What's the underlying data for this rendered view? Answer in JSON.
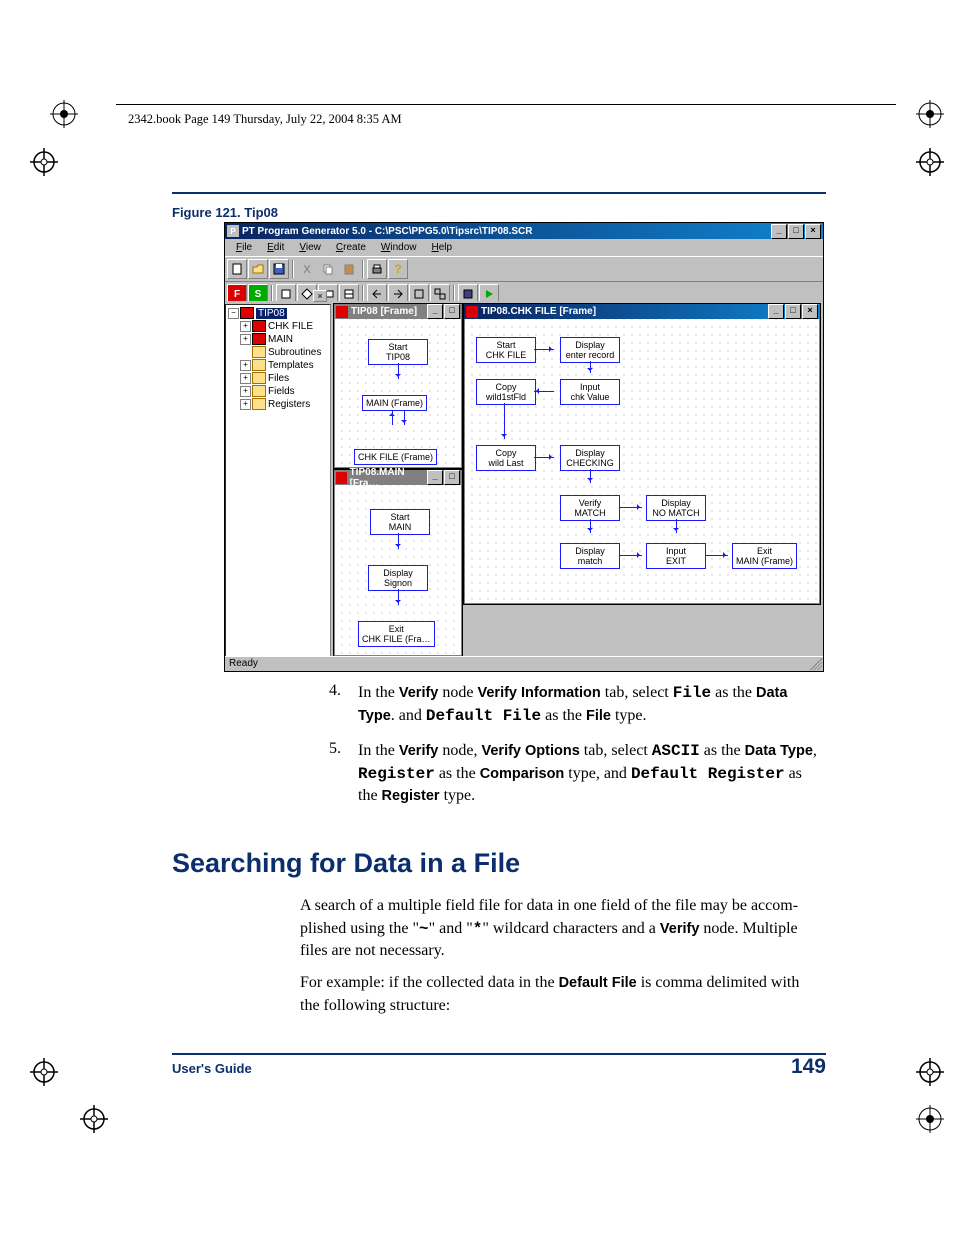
{
  "header": {
    "text": "2342.book  Page 149  Thursday, July 22, 2004  8:35 AM"
  },
  "figure": {
    "caption": "Figure 121. Tip08"
  },
  "screenshot": {
    "title": "PT Program Generator 5.0 - C:\\PSC\\PPG5.0\\Tipsrc\\TIP08.SCR",
    "menus": {
      "file": "File",
      "edit": "Edit",
      "view": "View",
      "create": "Create",
      "window": "Window",
      "help": "Help"
    },
    "tree": {
      "root": "TIP08",
      "items": [
        "CHK FILE",
        "MAIN",
        "Subroutines",
        "Templates",
        "Files",
        "Fields",
        "Registers"
      ]
    },
    "mdi1": {
      "title": "TIP08 [Frame]",
      "nodes": {
        "start": "Start\nTIP08",
        "main": "MAIN (Frame)",
        "chk": "CHK FILE (Frame)"
      }
    },
    "mdi2": {
      "title": "TIP08.MAIN [Fra…",
      "nodes": {
        "start": "Start\nMAIN",
        "disp": "Display\nSignon",
        "exit": "Exit\nCHK FILE (Fra…"
      }
    },
    "mdi3": {
      "title": "TIP08.CHK FILE [Frame]",
      "nodes": {
        "start": "Start\nCHK FILE",
        "denter": "Display\nenter record",
        "copy1": "Copy\nwild1stFld",
        "input1": "Input\nchk Value",
        "copy2": "Copy\nwild Last",
        "dcheck": "Display\nCHECKING",
        "verify": "Verify\nMATCH",
        "dnomatch": "Display\nNO MATCH",
        "dmatch": "Display\nmatch",
        "iexit": "Input\nEXIT",
        "exit": "Exit\nMAIN (Frame)"
      }
    },
    "status": "Ready"
  },
  "step4": {
    "num": "4.",
    "l1a": "In the ",
    "verify": "Verify",
    "l1b": " node ",
    "vinfo": "Verify Information",
    "l1c": " tab, select ",
    "file": "File",
    "l1d": " as the ",
    "dtype": "Data",
    "l2a": "Type",
    "l2b": ". and ",
    "dfile": "Default File",
    "l2c": " as the ",
    "ftype": "File",
    "l2d": " type."
  },
  "step5": {
    "num": "5.",
    "l1a": "In the ",
    "verify": "Verify",
    "l1b": " node, ",
    "vopt": "Verify Options",
    "l1c": " tab, select ",
    "ascii": "ASCII",
    "l1d": " as the ",
    "dtype": "Data Type",
    "l1e": ",",
    "l2a": "Register",
    "l2b": " as the ",
    "comp": "Comparison",
    "l2c": " type, and ",
    "dreg": "Default Register",
    "l2d": " as",
    "l3a": "the ",
    "rtype": "Register",
    "l3b": " type."
  },
  "heading": "Searching for Data in a File",
  "para1": {
    "l1": "A search of a multiple field file for data in one field of the file may be accom-",
    "l2a": "plished using the \"",
    "tilde": "~",
    "l2b": "\" and \"",
    "star": "*",
    "l2c": "\" wildcard characters and a ",
    "verify": "Verify",
    "l2d": " node. Multiple",
    "l3": "files are not necessary."
  },
  "para2": {
    "l1a": "For example: if the collected data in the ",
    "dfile": "Default File",
    "l1b": " is comma delimited with",
    "l2": "the following structure:"
  },
  "footer": {
    "left": "User's Guide",
    "right": "149"
  }
}
